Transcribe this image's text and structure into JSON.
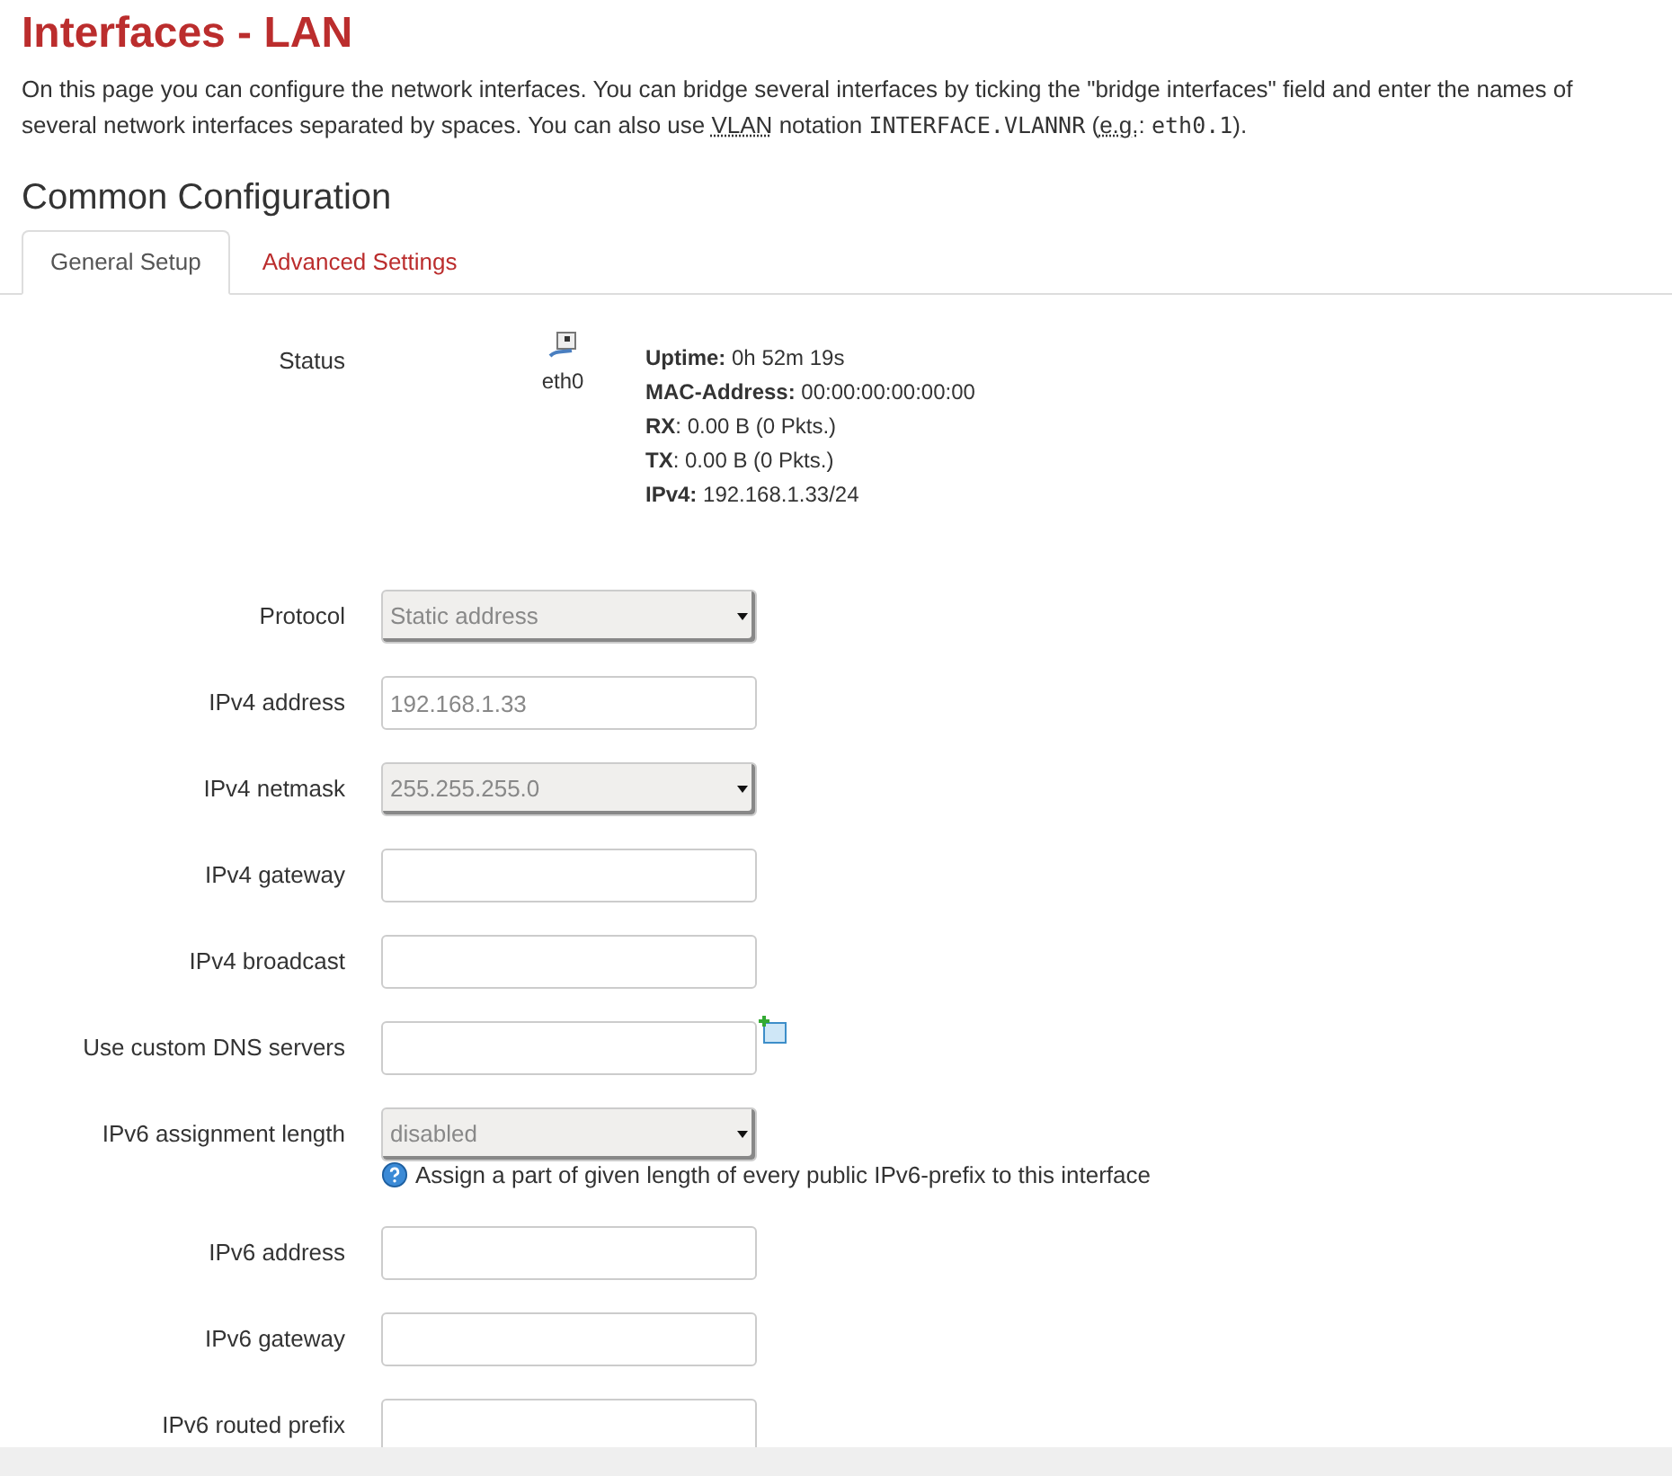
{
  "title": "Interfaces - LAN",
  "intro": [
    {
      "kind": "text",
      "text": "On this page you can configure the network interfaces. You can bridge several interfaces by ticking the \"bridge interfaces\" field and enter the names of several network interfaces separated by spaces. You can also use "
    },
    {
      "kind": "abbr",
      "text": "VLAN"
    },
    {
      "kind": "text",
      "text": " notation "
    },
    {
      "kind": "code",
      "text": "INTERFACE.VLANNR"
    },
    {
      "kind": "text",
      "text": " ("
    },
    {
      "kind": "abbr",
      "text": "e.g."
    },
    {
      "kind": "text",
      "text": ": "
    },
    {
      "kind": "code",
      "text": "eth0.1"
    },
    {
      "kind": "text",
      "text": ")."
    }
  ],
  "section_title": "Common Configuration",
  "tabs": [
    {
      "label": "General Setup",
      "selected": true
    },
    {
      "label": "Advanced Settings",
      "selected": false
    }
  ],
  "status": {
    "label": "Status",
    "device": "eth0",
    "lines": [
      "**Uptime:** 0h 52m 19s",
      "**MAC-Address:** 00:00:00:00:00:00",
      "**RX**: 0.00 B (0 Pkts.)",
      "**TX**: 0.00 B (0 Pkts.)",
      "**IPv4:** 192.168.1.33/24"
    ]
  },
  "fields": [
    {
      "label": "Protocol",
      "kind": "select",
      "value": "Static address"
    },
    {
      "label": "IPv4 address",
      "kind": "input",
      "value": "192.168.1.33"
    },
    {
      "label": "IPv4 netmask",
      "kind": "select",
      "value": "255.255.255.0"
    },
    {
      "label": "IPv4 gateway",
      "kind": "input"
    },
    {
      "label": "IPv4 broadcast",
      "kind": "input"
    },
    {
      "label": "Use custom DNS servers",
      "kind": "input",
      "add_button": true
    },
    {
      "label": "IPv6 assignment length",
      "kind": "select",
      "value": "disabled",
      "hint": "Assign a part of given length of every public IPv6-prefix to this interface"
    },
    {
      "label": "IPv6 address",
      "kind": "input"
    },
    {
      "label": "IPv6 gateway",
      "kind": "input"
    },
    {
      "label": "IPv6 routed prefix",
      "kind": "input"
    }
  ]
}
